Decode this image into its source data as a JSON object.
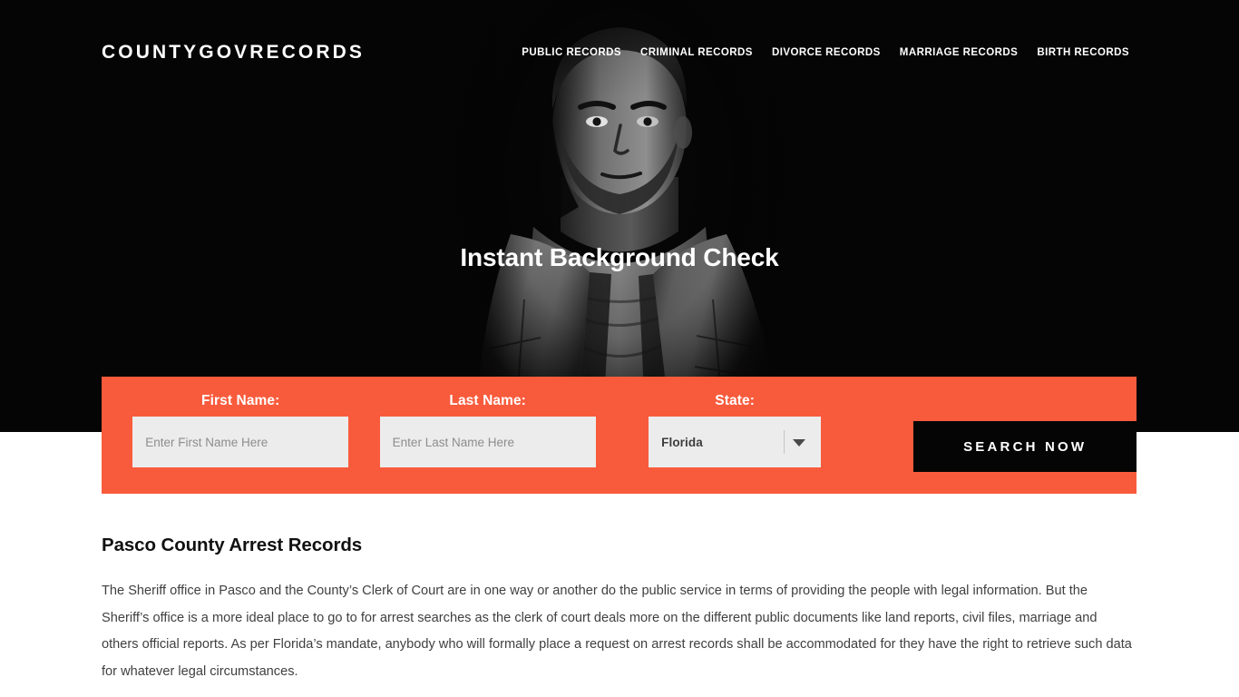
{
  "site": {
    "logo": "COUNTYGOVRECORDS",
    "accent_color": "#F85B3C",
    "hero_bg_color": "#050505",
    "button_color": "#050505",
    "input_bg_color": "#ECECEC"
  },
  "nav": {
    "items": [
      {
        "label": "PUBLIC RECORDS"
      },
      {
        "label": "CRIMINAL RECORDS"
      },
      {
        "label": "DIVORCE RECORDS"
      },
      {
        "label": "MARRIAGE RECORDS"
      },
      {
        "label": "BIRTH RECORDS"
      }
    ]
  },
  "hero": {
    "title": "Instant Background Check",
    "image_description": "black-and-white portrait of a bearded man wearing an open denim jacket over a graphic t-shirt"
  },
  "search_form": {
    "first_name": {
      "label": "First Name:",
      "placeholder": "Enter First Name Here",
      "value": ""
    },
    "last_name": {
      "label": "Last Name:",
      "placeholder": "Enter Last Name Here",
      "value": ""
    },
    "state": {
      "label": "State:",
      "selected": "Florida",
      "caret_icon": "chevron-down-icon"
    },
    "submit_label": "SEARCH NOW"
  },
  "article": {
    "title": "Pasco County Arrest Records",
    "paragraph": "The Sheriff office in Pasco and the County’s Clerk of Court are in one way or another do the public service in terms of providing the people with legal information. But the Sheriff’s office is a more ideal place to go to for arrest searches as the clerk of court deals more on the different public documents like land reports, civil files, marriage and others official reports. As per Florida’s mandate, anybody who will formally place a request on arrest records shall be accommodated for they have the right to retrieve such data for whatever legal circumstances."
  }
}
